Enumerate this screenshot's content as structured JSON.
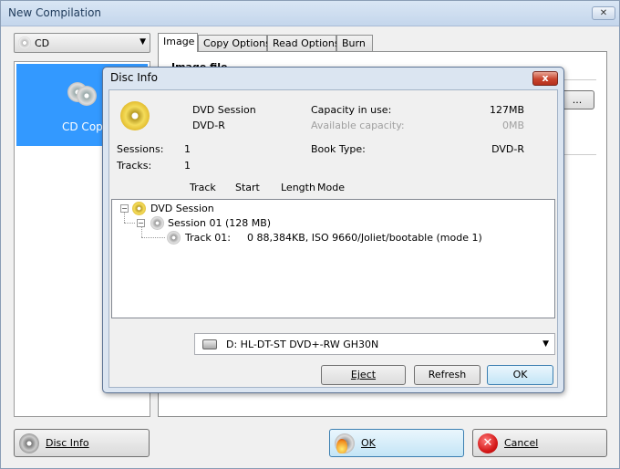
{
  "window": {
    "title": "New Compilation",
    "close_glyph": "✕"
  },
  "media_combo": {
    "value": "CD",
    "icon": "cd-icon"
  },
  "left_panel": {
    "selected_item": "CD Copy"
  },
  "tabs": [
    "Image",
    "Copy Options",
    "Read Options",
    "Burn"
  ],
  "image_tab": {
    "header": "Image file",
    "browse_label": "..."
  },
  "bottom_buttons": {
    "disc_info": "Disc Info",
    "ok": "OK",
    "cancel": "Cancel"
  },
  "disc_info": {
    "title": "Disc Info",
    "close_glyph": "x",
    "session_type": "DVD Session",
    "disc_type": "DVD-R",
    "capacity_in_use_label": "Capacity in use:",
    "capacity_in_use_value": "127MB",
    "available_capacity_label": "Available capacity:",
    "available_capacity_value": "0MB",
    "sessions_label": "Sessions:",
    "sessions_value": "1",
    "tracks_label": "Tracks:",
    "tracks_value": "1",
    "book_type_label": "Book Type:",
    "book_type_value": "DVD-R",
    "columns": {
      "track": "Track",
      "start": "Start",
      "length": "Length",
      "mode": "Mode"
    },
    "tree": {
      "root": "DVD Session",
      "session": "Session 01 (128 MB)",
      "track_label": "Track 01:",
      "track_info": "0 88,384KB, ISO 9660/Joliet/bootable (mode 1)"
    },
    "drive": "D: HL-DT-ST DVD+-RW GH30N",
    "buttons": {
      "eject": "Eject",
      "refresh": "Refresh",
      "ok": "OK"
    }
  },
  "colors": {
    "selection": "#3399ff",
    "dialog_frame": "#dbe5f1",
    "close_red": "#c9452e"
  }
}
